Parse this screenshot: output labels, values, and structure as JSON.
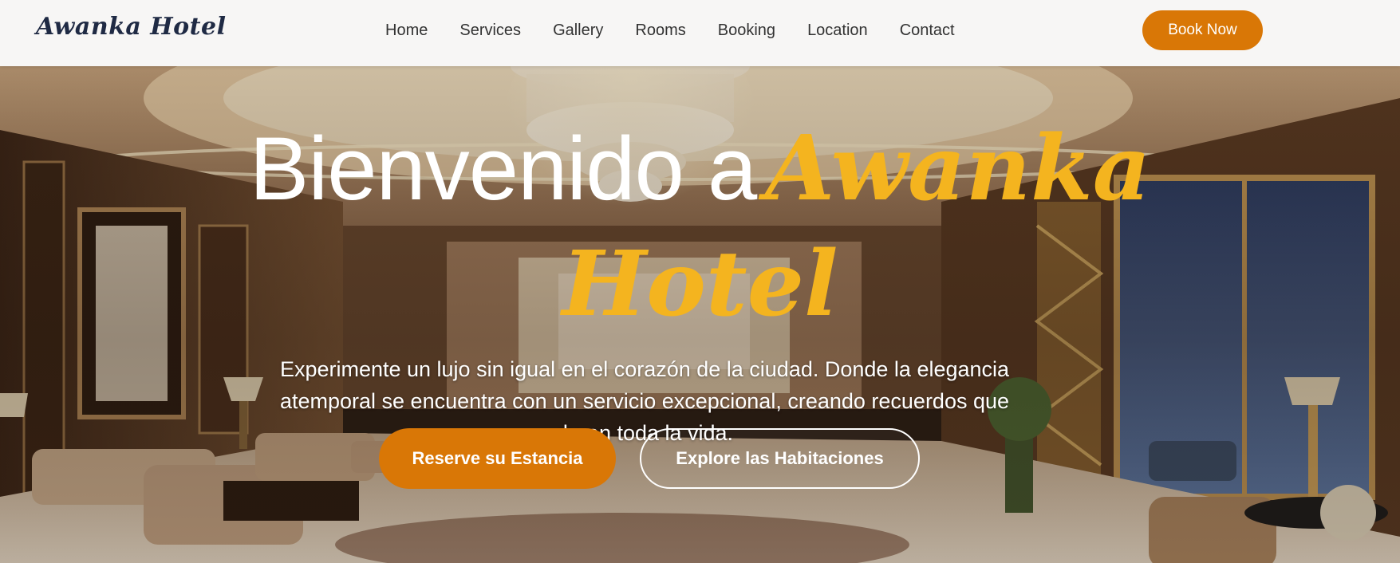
{
  "header": {
    "logo": "Awanka Hotel",
    "nav": [
      "Home",
      "Services",
      "Gallery",
      "Rooms",
      "Booking",
      "Location",
      "Contact"
    ],
    "book_now": "Book Now"
  },
  "hero": {
    "title_plain": "Bienvenido a",
    "title_brand_line1": "Awanka",
    "title_brand_line2": "Hotel",
    "subtitle": "Experimente un lujo sin igual en el corazón de la ciudad. Donde la elegancia atemporal se encuentra con un servicio excepcional, creando recuerdos que duran toda la vida.",
    "primary_cta": "Reserve su Estancia",
    "secondary_cta": "Explore las Habitaciones"
  },
  "colors": {
    "accent": "#d97706",
    "brand_gold": "#f4b41f",
    "logo": "#1f2a44",
    "header_bg": "#f7f6f5"
  }
}
